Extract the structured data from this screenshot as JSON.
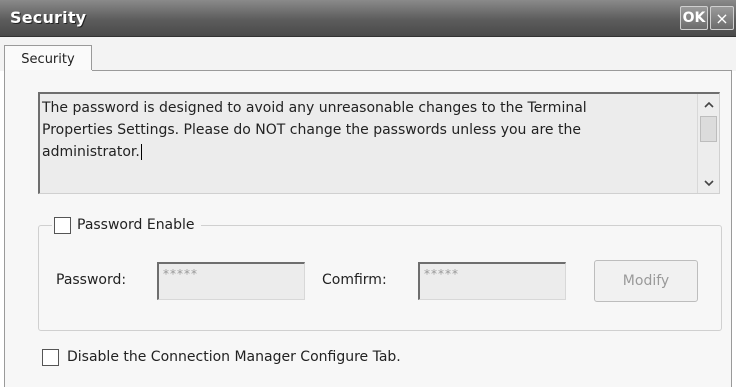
{
  "window": {
    "title": "Security",
    "ok_label": "OK",
    "close_label": "×"
  },
  "tabs": [
    {
      "label": "Security",
      "selected": true
    }
  ],
  "notice": {
    "line1": "The password is designed to avoid any unreasonable changes to the Terminal",
    "line2": "Properties Settings. Please do NOT change the passwords unless you are the",
    "line3": "administrator."
  },
  "password_group": {
    "enable_label": "Password Enable",
    "enable_checked": false,
    "password_label": "Password:",
    "password_value": "*****",
    "confirm_label": "Comfirm:",
    "confirm_value": "*****",
    "modify_label": "Modify",
    "modify_enabled": false
  },
  "connection_manager": {
    "label": "Disable the Connection Manager Configure Tab.",
    "checked": false
  },
  "icons": {
    "scroll_up": "chevron-up-icon",
    "scroll_down": "chevron-down-icon",
    "close": "close-icon"
  }
}
